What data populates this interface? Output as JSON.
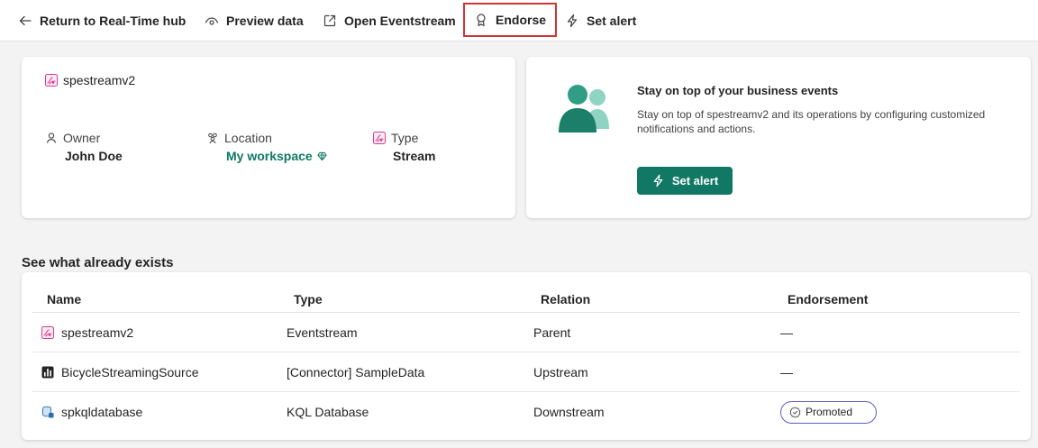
{
  "toolbar": {
    "back_label": "Return to Real-Time hub",
    "preview_label": "Preview data",
    "open_label": "Open Eventstream",
    "endorse_label": "Endorse",
    "alert_label": "Set alert"
  },
  "details": {
    "name": "spestreamv2",
    "owner_label": "Owner",
    "owner_value": "John Doe",
    "location_label": "Location",
    "location_value": "My workspace",
    "type_label": "Type",
    "type_value": "Stream"
  },
  "alert_card": {
    "title": "Stay on top of your business events",
    "description": "Stay on top of spestreamv2 and its operations by configuring customized notifications and actions.",
    "button_label": "Set alert"
  },
  "related": {
    "section_title": "See what already exists",
    "columns": [
      "Name",
      "Type",
      "Relation",
      "Endorsement"
    ],
    "rows": [
      {
        "name": "spestreamv2",
        "type": "Eventstream",
        "relation": "Parent",
        "endorsement": "—",
        "icon": "eventstream-icon"
      },
      {
        "name": "BicycleStreamingSource",
        "type": "[Connector] SampleData",
        "relation": "Upstream",
        "endorsement": "—",
        "icon": "source-chart-icon"
      },
      {
        "name": "spkqldatabase",
        "type": "KQL Database",
        "relation": "Downstream",
        "endorsement": "Promoted",
        "icon": "kql-database-icon"
      }
    ]
  },
  "colors": {
    "accent": "#117865",
    "highlight_border": "#d13438",
    "eventstream_icon": "#d63b8f",
    "badge_border": "#5b5fc7"
  }
}
